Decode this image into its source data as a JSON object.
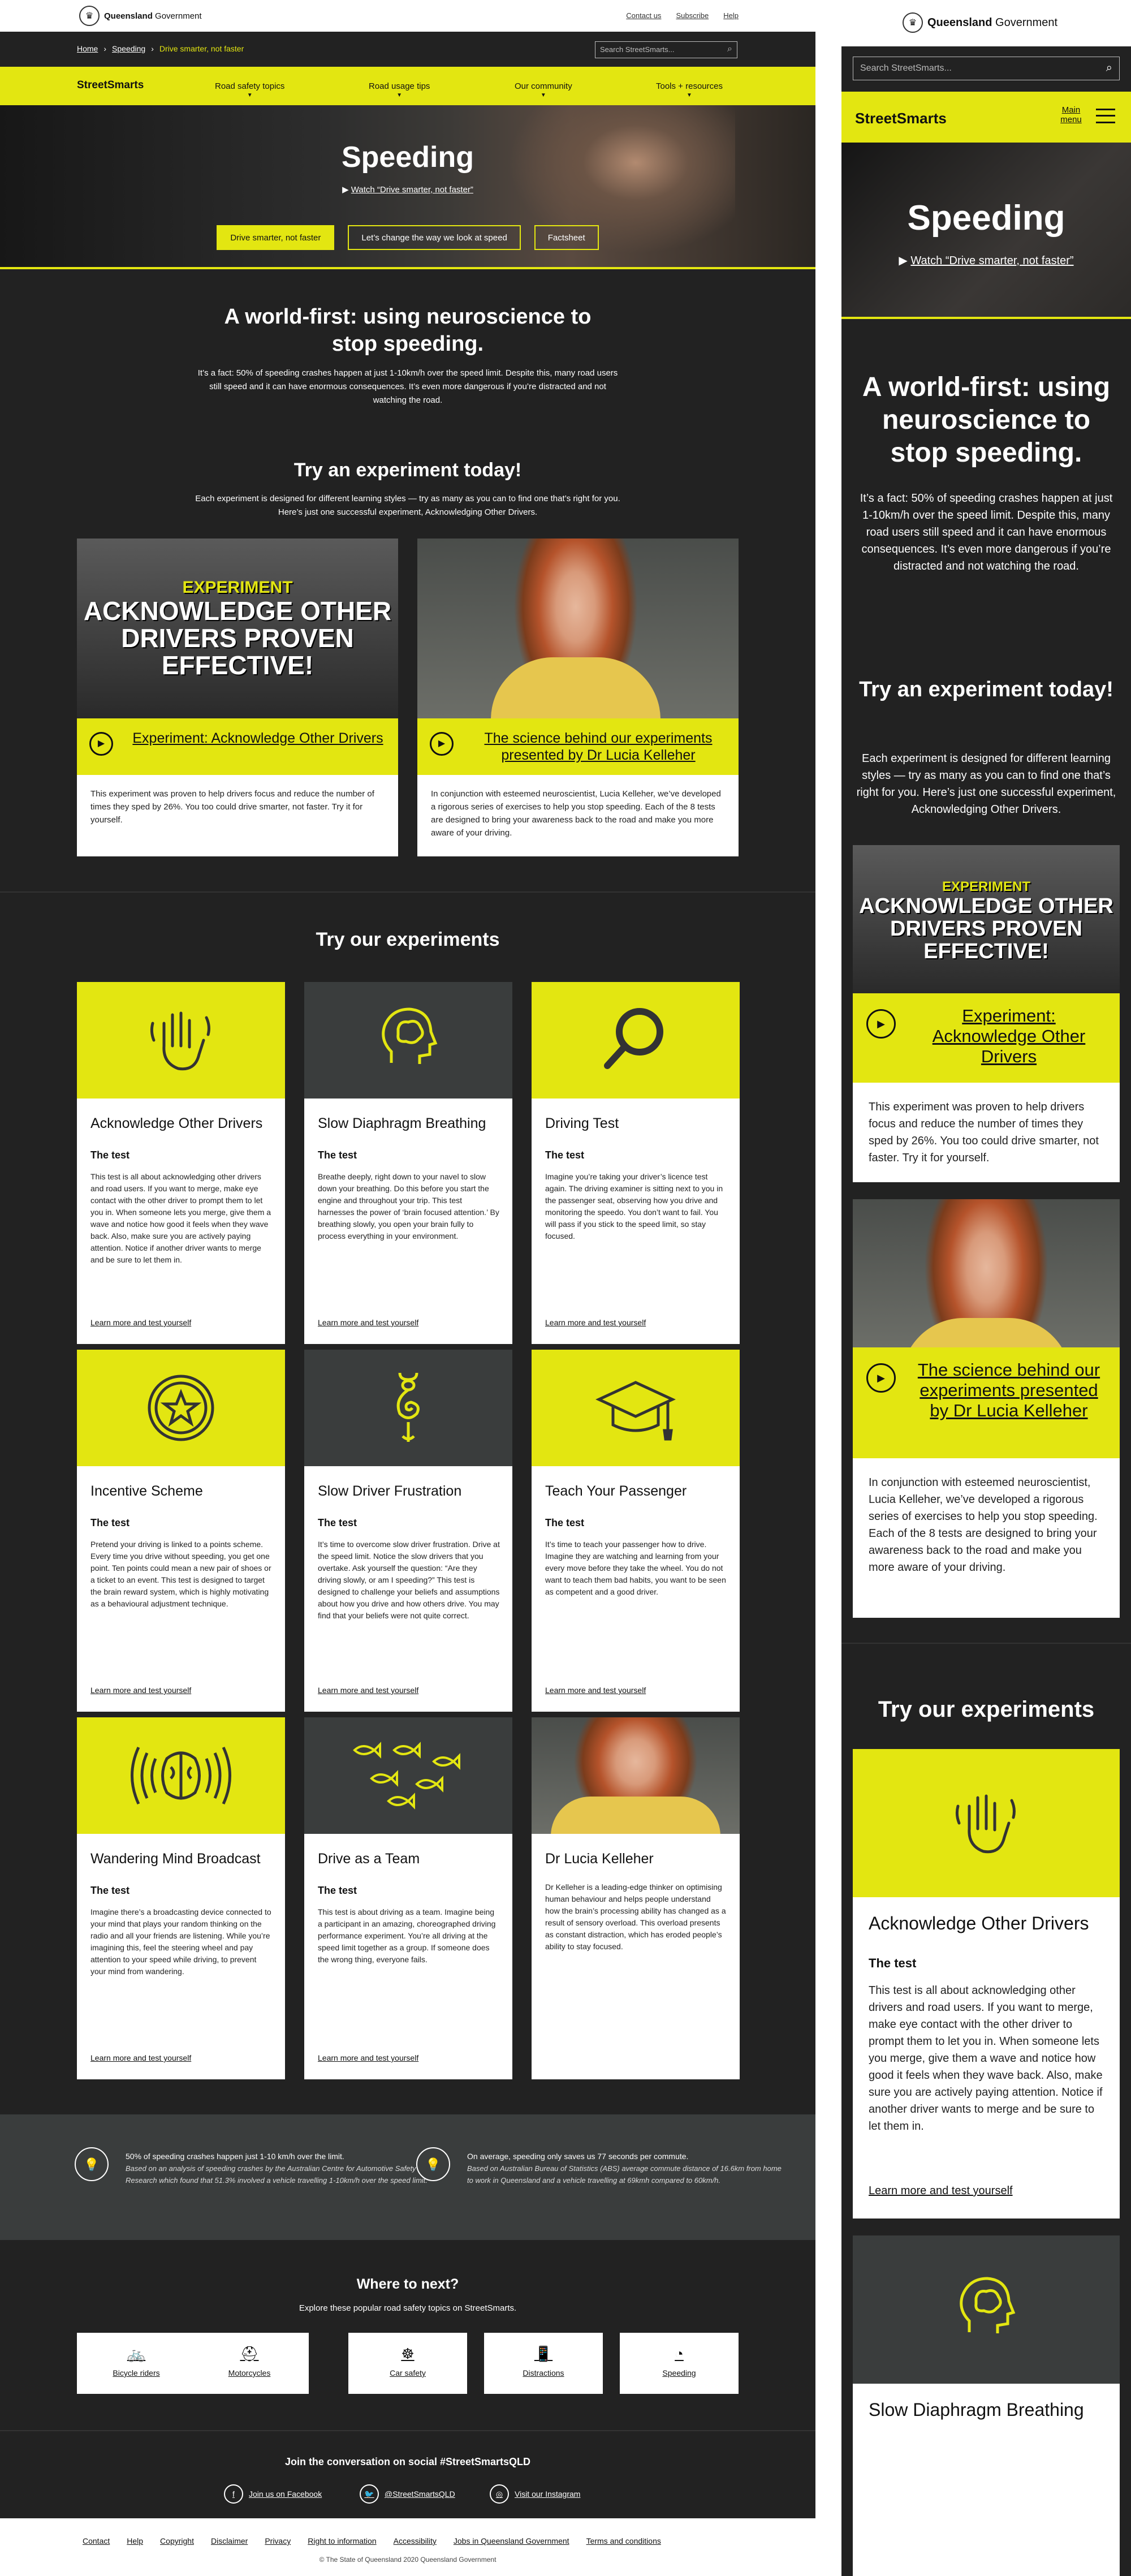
{
  "site": {
    "gov_name": "Queensland Government",
    "gov_name_bold": "Queensland",
    "gov_name_rest": "Government",
    "top_links": [
      "Contact us",
      "Subscribe",
      "Help"
    ],
    "search_placeholder": "Search StreetSmarts...",
    "mobile_search_placeholder": "Search StreetSmarts...",
    "brand": "StreetSmarts",
    "nav": [
      "Road safety topics",
      "Road usage tips",
      "Our community",
      "Tools + resources"
    ],
    "mobile_menu_label": "Main menu"
  },
  "breadcrumb": {
    "home": "Home",
    "section": "Speeding",
    "current": "Drive smarter, not faster"
  },
  "hero": {
    "title": "Speeding",
    "watch_text": "Watch “Drive smarter, not faster”",
    "buttons": [
      "Drive smarter, not faster",
      "Let’s change the way we look at speed",
      "Factsheet"
    ]
  },
  "intro": {
    "heading": "A world-first: using neuroscience to stop speeding.",
    "lead_desktop": "It’s a fact: 50% of speeding crashes happen at just 1-10km/h over the speed limit. Despite this, many road users still speed and it can have enormous consequences. It’s even more dangerous if you’re distracted and not watching the road.",
    "lead_mobile": "It’s a fact: 50% of speeding crashes happen at just 1-10km/h over the speed limit. Despite this, many road users still speed and it can have enormous consequences. It’s even more dangerous if you’re distracted and not watching the road.",
    "try_heading": "Try an experiment today!",
    "try_sub": "Each experiment is designed for different learning styles — try as many as you can to find one that’s right for you. Here’s just one successful experiment, Acknowledging Other Drivers."
  },
  "featured": [
    {
      "image_tag": "EXPERIMENT",
      "image_text": "ACKNOWLEDGE OTHER DRIVERS PROVEN EFFECTIVE!",
      "caption": "Experiment: Acknowledge Other Drivers",
      "desc": "This experiment was proven to help drivers focus and reduce the number of times they sped by 26%. You too could drive smarter, not faster. Try it for yourself."
    },
    {
      "caption": "The science behind our experiments presented by Dr Lucia Kelleher",
      "desc": "In conjunction with esteemed neuroscientist, Lucia Kelleher, we’ve developed a rigorous series of exercises to help you stop speeding. Each of the 8 tests are designed to bring your awareness back to the road and make you more aware of your driving."
    }
  ],
  "experiments": {
    "heading": "Try our experiments",
    "test_label": "The test",
    "link_label": "Learn more and test yourself",
    "items": [
      {
        "title": "Acknowledge Other Drivers",
        "icon": "waving-hand-icon",
        "bg": "#e3e611",
        "text": "This test is all about acknowledging other drivers and road users. If you want to merge, make eye contact with the other driver to prompt them to let you in. When someone lets you merge, give them a wave and notice how good it feels when they wave back. Also, make sure you are actively paying attention. Notice if another driver wants to merge and be sure to let them in."
      },
      {
        "title": "Slow Diaphragm Breathing",
        "icon": "brain-head-icon",
        "bg": "#3a3d3d",
        "text": "Breathe deeply, right down to your navel to slow down your breathing. Do this before you start the engine and throughout your trip. This test harnesses the power of ‘brain focused attention.’ By breathing slowly, you open your brain fully to process everything in your environment."
      },
      {
        "title": "Driving Test",
        "icon": "magnifier-icon",
        "bg": "#e3e611",
        "text": "Imagine you’re taking your driver’s licence test again. The driving examiner is sitting next to you in the passenger seat, observing how you drive and monitoring the speedo. You don’t want to fail. You will pass if you stick to the speed limit, so stay focused."
      },
      {
        "title": "Incentive Scheme",
        "icon": "star-badge-icon",
        "bg": "#e3e611",
        "text": "Pretend your driving is linked to a points scheme. Every time you drive without speeding, you get one point. Ten points could mean a new pair of shoes or a ticket to an event. This test is designed to target the brain reward system, which is highly motivating as a behavioural adjustment technique."
      },
      {
        "title": "Slow Driver Frustration",
        "icon": "snail-icon",
        "bg": "#3a3d3d",
        "text": "It’s time to overcome slow driver frustration. Drive at the speed limit. Notice the slow drivers that you overtake. Ask yourself the question: “Are they driving slowly, or am I speeding?” This test is designed to challenge your beliefs and assumptions about how you drive and how others drive. You may find that your beliefs were not quite correct."
      },
      {
        "title": "Teach Your Passenger",
        "icon": "graduation-cap-icon",
        "bg": "#e3e611",
        "text": "It’s time to teach your passenger how to drive. Imagine they are watching and learning from your every move before they take the wheel. You do not want to teach them bad habits, you want to be seen as competent and a good driver."
      },
      {
        "title": "Wandering Mind Broadcast",
        "icon": "brain-broadcast-icon",
        "bg": "#e3e611",
        "text": "Imagine there’s a broadcasting device connected to your mind that plays your random thinking on the radio and all your friends are listening. While you’re imagining this, feel the steering wheel and pay attention to your speed while driving, to prevent your mind from wandering."
      },
      {
        "title": "Drive as a Team",
        "icon": "fish-school-icon",
        "bg": "#3a3d3d",
        "text": "This test is about driving as a team. Imagine being a participant in an amazing, choreographed driving performance experiment. You’re all driving at the speed limit together as a group. If someone does the wrong thing, everyone fails."
      },
      {
        "title": "Dr Lucia Kelleher",
        "icon": "portrait",
        "bg": "#55585a",
        "text": "Dr Kelleher is a leading-edge thinker on optimising human behaviour and helps people understand how the brain’s processing ability has changed as a result of sensory overload. This overload presents as constant distraction, which has eroded people’s ability to stay focused."
      }
    ]
  },
  "stats": [
    {
      "text": "50% of speeding crashes happen just 1-10 km/h over the limit.",
      "note": "Based on an analysis of speeding crashes by the Australian Centre for Automotive Safety Research which found that 51.3% involved a vehicle travelling 1-10km/h over the speed limit."
    },
    {
      "text": "On average, speeding only saves us 77 seconds per commute.",
      "note": "Based on Australian Bureau of Statistics (ABS) average commute distance of 16.6km from home to work in Queensland and a vehicle travelling at 69kmh compared to 60km/h."
    }
  ],
  "where": {
    "heading": "Where to next?",
    "sub": "Explore these popular road safety topics on StreetSmarts.",
    "tiles": [
      {
        "label": "Bicycle riders",
        "icon": "bicycle-icon"
      },
      {
        "label": "Motorcycles",
        "icon": "helmet-icon"
      },
      {
        "label": "Car safety",
        "icon": "steering-wheel-icon"
      },
      {
        "label": "Distractions",
        "icon": "phone-icon"
      },
      {
        "label": "Speeding",
        "icon": "speedometer-icon"
      }
    ]
  },
  "social": {
    "heading": "Join the conversation on social #StreetSmartsQLD",
    "links": [
      {
        "label": "Join us on Facebook",
        "icon": "facebook-icon"
      },
      {
        "label": "@StreetSmartsQLD",
        "icon": "twitter-icon"
      },
      {
        "label": "Visit our Instagram",
        "icon": "instagram-icon"
      }
    ]
  },
  "footer": {
    "links": [
      "Contact",
      "Help",
      "Copyright",
      "Disclaimer",
      "Privacy",
      "Right to information",
      "Accessibility",
      "Jobs in Queensland Government",
      "Terms and conditions"
    ],
    "copyright": "© The State of Queensland 2020 Queensland Government"
  },
  "colors": {
    "accent": "#e3e611",
    "dark": "#222222",
    "panel": "#3a3d3d"
  }
}
